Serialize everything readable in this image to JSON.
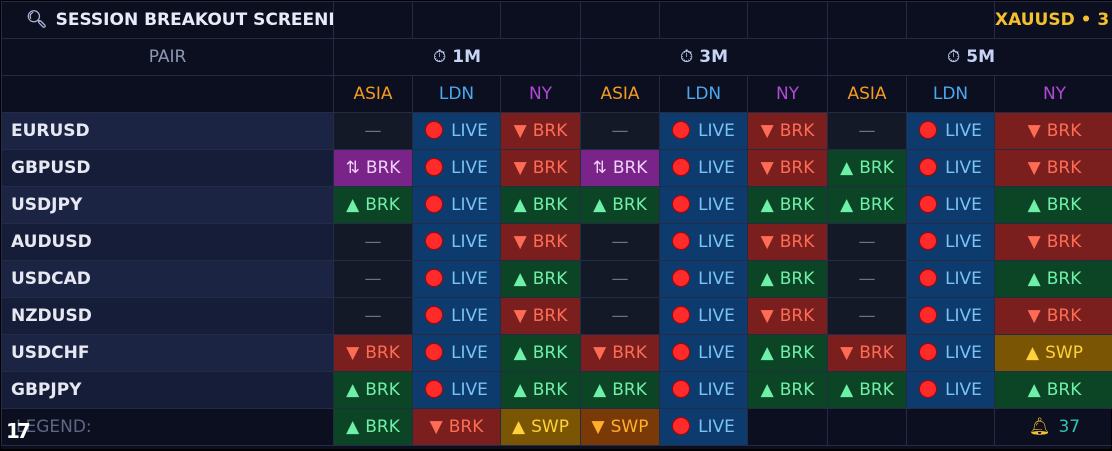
{
  "title": "SESSION BREAKOUT SCREENER",
  "symbol_badge": "XAUUSD • 3",
  "pair_header": "PAIR",
  "timeframes": [
    "1M",
    "3M",
    "5M"
  ],
  "sessions": [
    "ASIA",
    "LDN",
    "NY"
  ],
  "rows": [
    {
      "pair": "EURUSD",
      "cells": [
        "empty",
        "live",
        "down",
        "empty",
        "live",
        "down",
        "empty",
        "live",
        "down"
      ]
    },
    {
      "pair": "GBPUSD",
      "cells": [
        "both",
        "live",
        "down",
        "both",
        "live",
        "down",
        "up",
        "live",
        "down"
      ]
    },
    {
      "pair": "USDJPY",
      "cells": [
        "up",
        "live",
        "up",
        "up",
        "live",
        "up",
        "up",
        "live",
        "up"
      ]
    },
    {
      "pair": "AUDUSD",
      "cells": [
        "empty",
        "live",
        "down",
        "empty",
        "live",
        "down",
        "empty",
        "live",
        "down"
      ]
    },
    {
      "pair": "USDCAD",
      "cells": [
        "empty",
        "live",
        "up",
        "empty",
        "live",
        "up",
        "empty",
        "live",
        "up"
      ]
    },
    {
      "pair": "NZDUSD",
      "cells": [
        "empty",
        "live",
        "down",
        "empty",
        "live",
        "down",
        "empty",
        "live",
        "down"
      ]
    },
    {
      "pair": "USDCHF",
      "cells": [
        "down",
        "live",
        "up",
        "down",
        "live",
        "up",
        "down",
        "live",
        "swp"
      ]
    },
    {
      "pair": "GBPJPY",
      "cells": [
        "up",
        "live",
        "up",
        "up",
        "live",
        "up",
        "up",
        "live",
        "up"
      ]
    }
  ],
  "states": {
    "empty": {
      "symbol": "",
      "label": "—"
    },
    "live": {
      "symbol": "",
      "label": "LIVE"
    },
    "down": {
      "symbol": "▼",
      "label": "BRK"
    },
    "up": {
      "symbol": "▲",
      "label": "BRK"
    },
    "both": {
      "symbol": "⇅",
      "label": "BRK"
    },
    "swp": {
      "symbol": "▲",
      "label": "SWP"
    }
  },
  "legend": {
    "label": "LEGEND:",
    "items": [
      {
        "state": "up",
        "symbol": "▲",
        "label": "BRK"
      },
      {
        "state": "down",
        "symbol": "▼",
        "label": "BRK"
      },
      {
        "state": "swp",
        "symbol": "▲",
        "label": "SWP"
      },
      {
        "state": "swpdn",
        "symbol": "▼",
        "label": "SWP"
      },
      {
        "state": "live",
        "symbol": "",
        "label": "LIVE"
      }
    ],
    "alert_count": "37"
  },
  "colors": {
    "asia": "#f59a22",
    "ldn": "#4ba8ee",
    "ny": "#b34ad8",
    "up": "#6ff0a8",
    "down": "#ff6c55",
    "swp": "#ffd13b",
    "live_dot": "#ff2b2b"
  },
  "icons": {
    "title": "search-icon",
    "timeframe": "stopwatch-icon",
    "alert": "bell-icon",
    "logo": "tradingview-logo"
  }
}
